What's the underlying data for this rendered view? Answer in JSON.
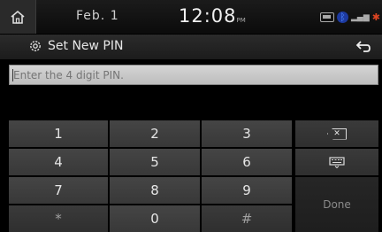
{
  "status": {
    "date": "Feb.  1",
    "time": "12:08",
    "ampm": "PM"
  },
  "header": {
    "title": "Set New PIN"
  },
  "pin": {
    "placeholder": "Enter the 4 digit PIN.",
    "value": ""
  },
  "keypad": {
    "row1": [
      "1",
      "2",
      "3"
    ],
    "row2": [
      "4",
      "5",
      "6"
    ],
    "row3": [
      "7",
      "8",
      "9"
    ],
    "row4": [
      "*",
      "0",
      "#"
    ],
    "done_label": "Done"
  },
  "icons": {
    "home": "home-icon",
    "settings": "gear-icon",
    "back": "back-arrow-icon",
    "backspace": "backspace-icon",
    "keyboard": "keyboard-icon"
  },
  "colors": {
    "background": "#000000",
    "key": "#404040",
    "field": "#c8c8c8"
  }
}
